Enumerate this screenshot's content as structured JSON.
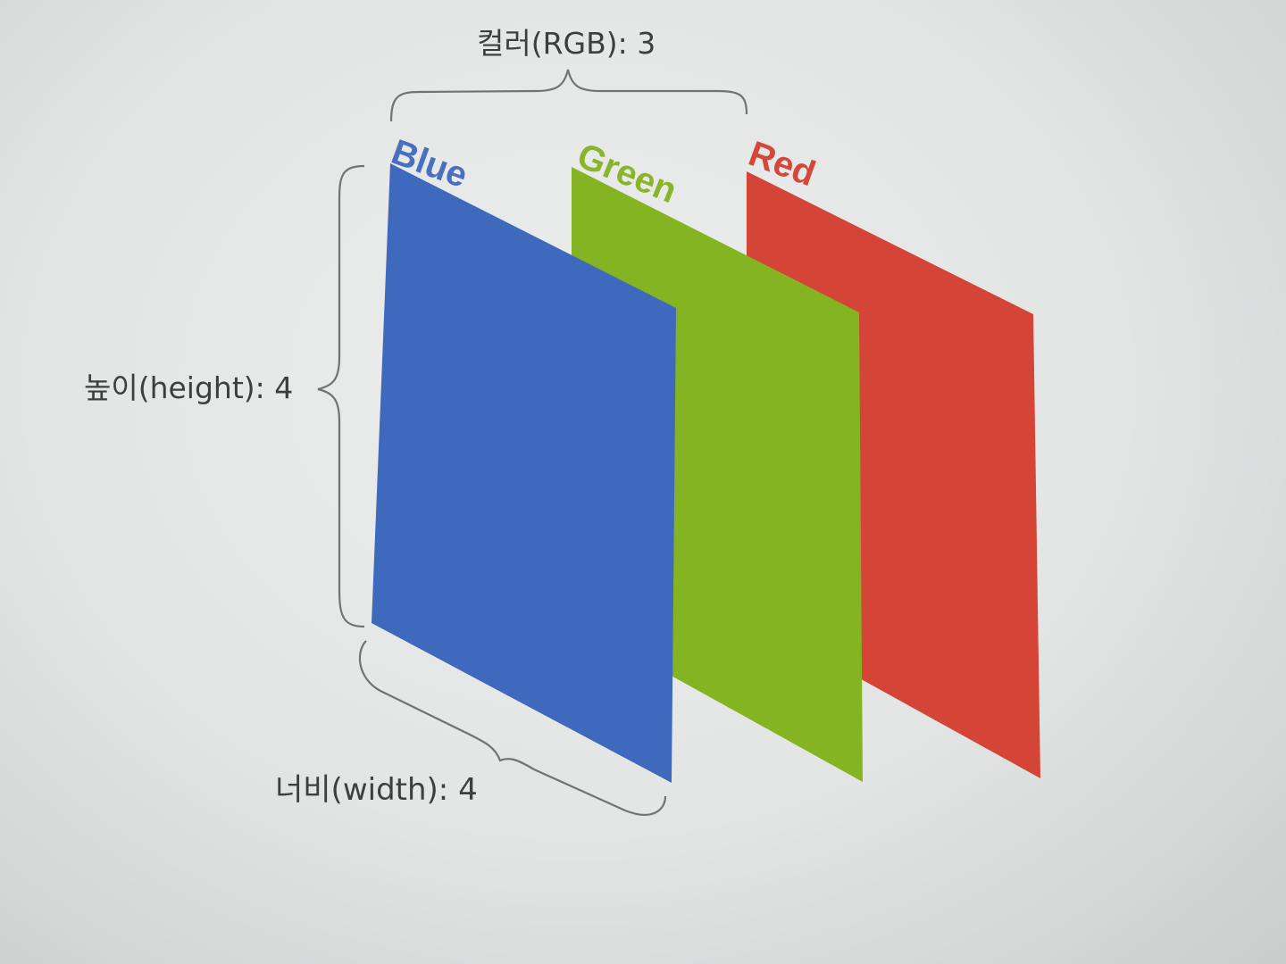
{
  "diagram": {
    "color_label": "컬러(RGB): 3",
    "height_label": "높이(height): 4",
    "width_label": "너비(width): 4",
    "channels": [
      {
        "name": "Blue",
        "color": "#3f69bd",
        "label_color": "#4a6fc0"
      },
      {
        "name": "Green",
        "color": "#84b421",
        "label_color": "#8ab52a"
      },
      {
        "name": "Red",
        "color": "#d44437",
        "label_color": "#d4483a"
      }
    ],
    "bracket_color": "#6e7374"
  }
}
